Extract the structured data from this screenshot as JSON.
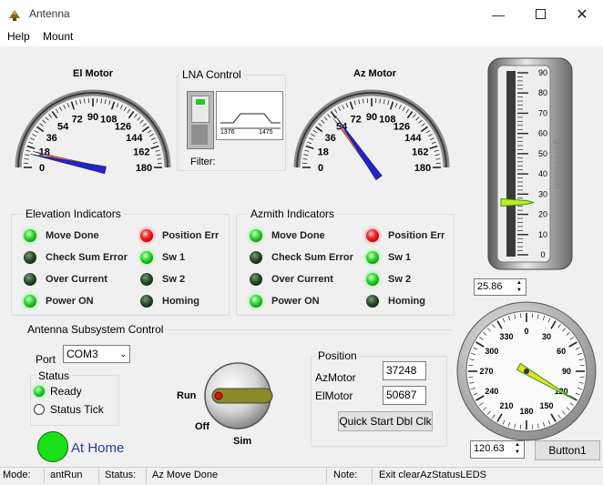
{
  "window": {
    "title": "Antenna"
  },
  "menu": {
    "help": "Help",
    "mount": "Mount"
  },
  "el_motor": {
    "title": "El Motor",
    "ticks": [
      "0",
      "18",
      "36",
      "54",
      "72",
      "90",
      "108",
      "126",
      "144",
      "162",
      "180"
    ],
    "needle_value": 12,
    "target_value": 15
  },
  "lna": {
    "title": "LNA Control",
    "filter_label": "Filter:",
    "freq_low": "1376",
    "freq_high": "1475"
  },
  "az_motor": {
    "title": "Az Motor",
    "ticks": [
      "0",
      "18",
      "36",
      "54",
      "72",
      "90",
      "108",
      "126",
      "144",
      "162",
      "180"
    ],
    "needle_value": 55,
    "target_value": 52
  },
  "elevation_bar": {
    "label": "gElevation",
    "ticks": [
      "0",
      "10",
      "20",
      "30",
      "40",
      "50",
      "60",
      "70",
      "80",
      "90"
    ],
    "value": 25.86
  },
  "elevation_indicators": {
    "title": "Elevation Indicators",
    "left": [
      {
        "label": "Move Done",
        "state": "green"
      },
      {
        "label": "Check Sum Error",
        "state": "dark"
      },
      {
        "label": "Over Current",
        "state": "dark"
      },
      {
        "label": "Power ON",
        "state": "green"
      }
    ],
    "right": [
      {
        "label": "Position Err",
        "state": "red"
      },
      {
        "label": "Sw 1",
        "state": "green"
      },
      {
        "label": "Sw 2",
        "state": "dark"
      },
      {
        "label": "Homing",
        "state": "dark"
      }
    ]
  },
  "azimuth_indicators": {
    "title": "Azmith Indicators",
    "left": [
      {
        "label": "Move Done",
        "state": "green"
      },
      {
        "label": "Check Sum Error",
        "state": "dark"
      },
      {
        "label": "Over Current",
        "state": "dark"
      },
      {
        "label": "Power ON",
        "state": "green"
      }
    ],
    "right": [
      {
        "label": "Position Err",
        "state": "red"
      },
      {
        "label": "Sw 1",
        "state": "green"
      },
      {
        "label": "Sw 2",
        "state": "green"
      },
      {
        "label": "Homing",
        "state": "dark"
      }
    ]
  },
  "elevation_value": "25.86",
  "azimuth_value": "120.63",
  "compass": {
    "ticks": [
      "0",
      "30",
      "60",
      "90",
      "120",
      "150",
      "180",
      "210",
      "240",
      "270",
      "300",
      "330"
    ],
    "needle_value": 120.63
  },
  "subsystem": {
    "title": "Antenna Subsystem Control",
    "port_label": "Port",
    "port_value": "COM3",
    "status_title": "Status",
    "ready_label": "Ready",
    "status_tick_label": "Status Tick",
    "at_home": "At Home",
    "switch_run": "Run",
    "switch_off": "Off",
    "switch_sim": "Sim"
  },
  "position": {
    "title": "Position",
    "az_label": "AzMotor",
    "az_value": "37248",
    "el_label": "ElMotor",
    "el_value": "50687",
    "quick_start": "Quick Start Dbl Clk"
  },
  "button1": "Button1",
  "status_bar": {
    "mode_label": "Mode:",
    "mode_value": "antRun",
    "status_label": "Status:",
    "status_value": "Az Move Done",
    "note_label": "Note:",
    "note_value": "Exit clearAzStatusLEDS"
  },
  "colors": {
    "led_green": "#3ee03e",
    "led_red": "#ff2a2a",
    "at_home": "#1a9e1a",
    "at_home_text": "#1f3f9f"
  }
}
